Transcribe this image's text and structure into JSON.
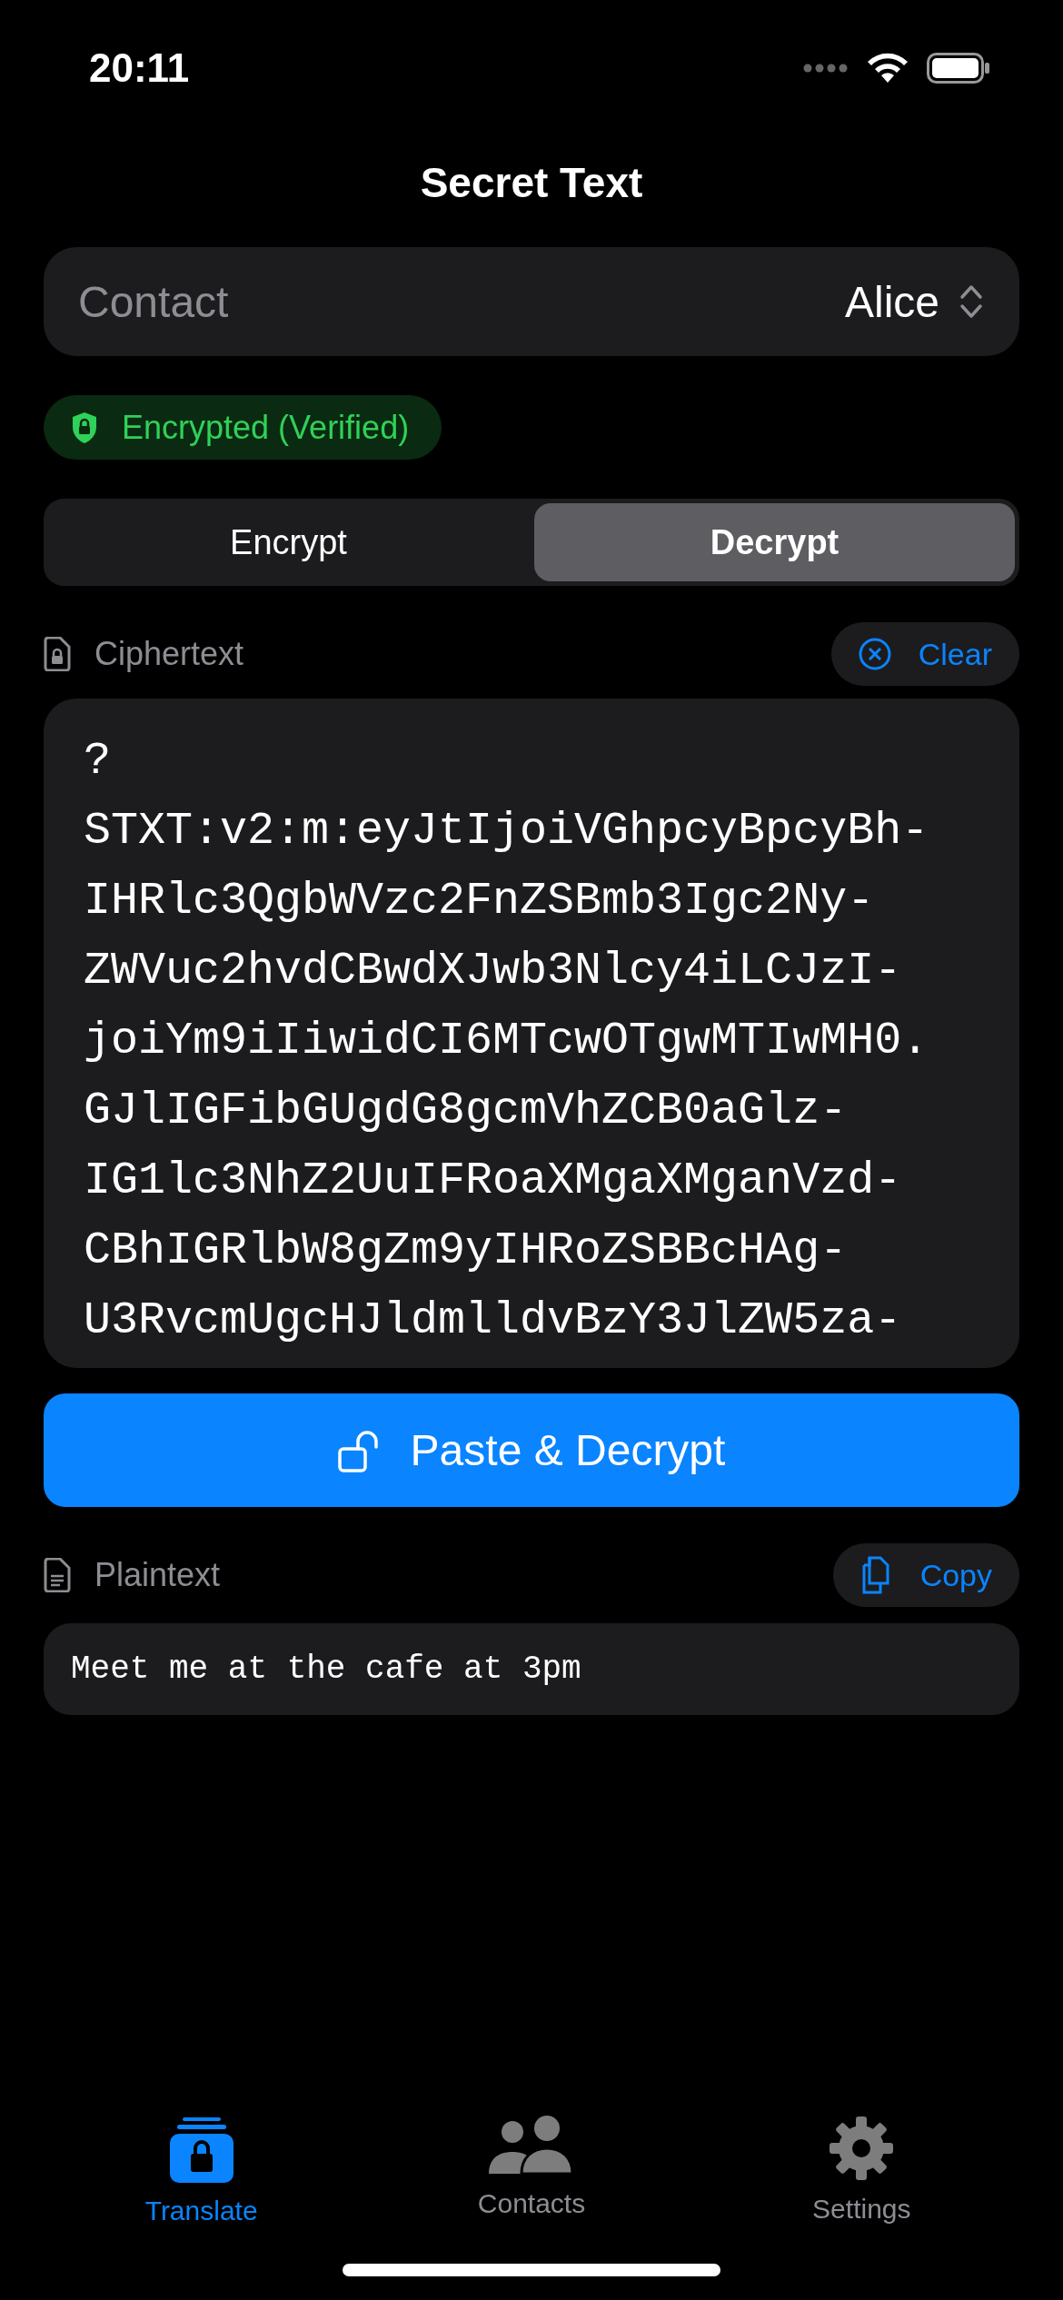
{
  "status_bar": {
    "time": "20:11"
  },
  "title": "Secret Text",
  "contact": {
    "label": "Contact",
    "value": "Alice"
  },
  "badge": {
    "text": "Encrypted (Verified)"
  },
  "modes": [
    {
      "label": "Encrypt",
      "selected": false
    },
    {
      "label": "Decrypt",
      "selected": true
    }
  ],
  "ciphertext": {
    "label": "Ciphertext",
    "action": "Clear",
    "lines": [
      "?",
      "STXT:v2:m:eyJtIjoiVGhpcyBpcyBh-",
      "IHRlc3QgbWVzc2FnZSBmb3Igc2Ny-",
      "ZWVuc2hvdCBwdXJwb3Nlcy4iLCJzI-",
      "joiYm9iIiwidCI6MTcwOTgwMTIwMH0.",
      "GJlIGFibGUgdG8gcmVhZCB0aGlz-",
      "IG1lc3NhZ2UuIFRoaXMgaXMganVzd-",
      "CBhIGRlbW8gZm9yIHRoZSBBcHAg-",
      "U3RvcmUgcHJldmlldvBzY3JlZW5za-"
    ]
  },
  "primary_button": "Paste & Decrypt",
  "plaintext": {
    "label": "Plaintext",
    "action": "Copy",
    "value": "Meet me at the cafe at 3pm"
  },
  "tabs": [
    {
      "label": "Translate",
      "kind": "translate",
      "selected": true
    },
    {
      "label": "Contacts",
      "kind": "contacts",
      "selected": false
    },
    {
      "label": "Settings",
      "kind": "settings",
      "selected": false
    }
  ]
}
